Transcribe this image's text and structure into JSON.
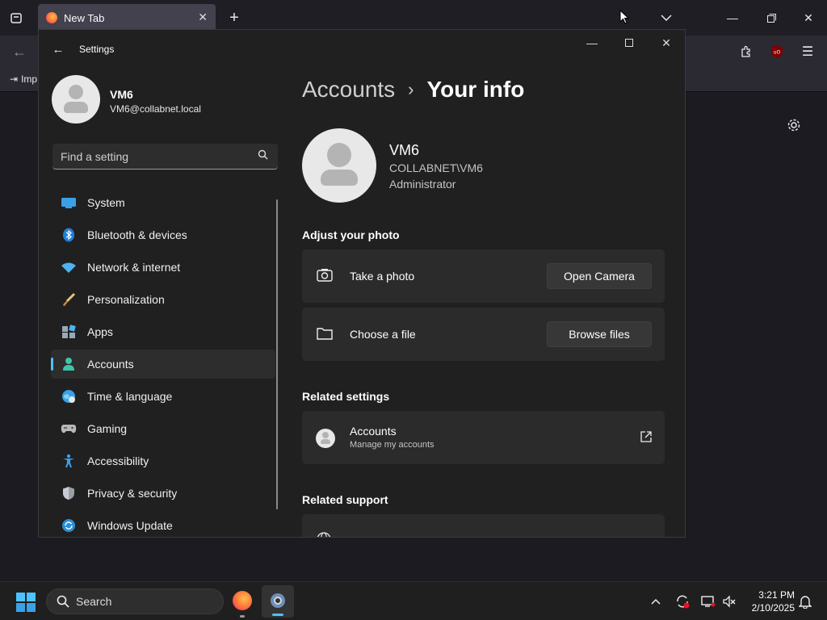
{
  "firefox": {
    "tab_title": "New Tab",
    "bookmark_label": "Imp"
  },
  "settings": {
    "window_title": "Settings",
    "user": {
      "name": "VM6",
      "email": "VM6@collabnet.local"
    },
    "search": {
      "placeholder": "Find a setting"
    },
    "nav": [
      {
        "label": "System",
        "icon": "system-icon"
      },
      {
        "label": "Bluetooth & devices",
        "icon": "bluetooth-icon"
      },
      {
        "label": "Network & internet",
        "icon": "network-icon"
      },
      {
        "label": "Personalization",
        "icon": "brush-icon"
      },
      {
        "label": "Apps",
        "icon": "apps-icon"
      },
      {
        "label": "Accounts",
        "icon": "accounts-icon",
        "active": true
      },
      {
        "label": "Time & language",
        "icon": "globe-clock-icon"
      },
      {
        "label": "Gaming",
        "icon": "gamepad-icon"
      },
      {
        "label": "Accessibility",
        "icon": "accessibility-icon"
      },
      {
        "label": "Privacy & security",
        "icon": "shield-icon"
      },
      {
        "label": "Windows Update",
        "icon": "update-icon"
      }
    ],
    "breadcrumb": {
      "parent": "Accounts",
      "separator": "›",
      "current": "Your info"
    },
    "profile": {
      "name": "VM6",
      "domain_user": "COLLABNET\\VM6",
      "role": "Administrator"
    },
    "adjust_photo": {
      "title": "Adjust your photo",
      "take_photo": {
        "label": "Take a photo",
        "button": "Open Camera"
      },
      "choose_file": {
        "label": "Choose a file",
        "button": "Browse files"
      }
    },
    "related_settings": {
      "title": "Related settings",
      "accounts": {
        "label": "Accounts",
        "sublabel": "Manage my accounts"
      }
    },
    "related_support": {
      "title": "Related support"
    }
  },
  "taskbar": {
    "search_label": "Search",
    "time": "3:21 PM",
    "date": "2/10/2025"
  },
  "colors": {
    "accent": "#4cc2ff",
    "bg": "#202020",
    "card": "#2b2b2b"
  }
}
